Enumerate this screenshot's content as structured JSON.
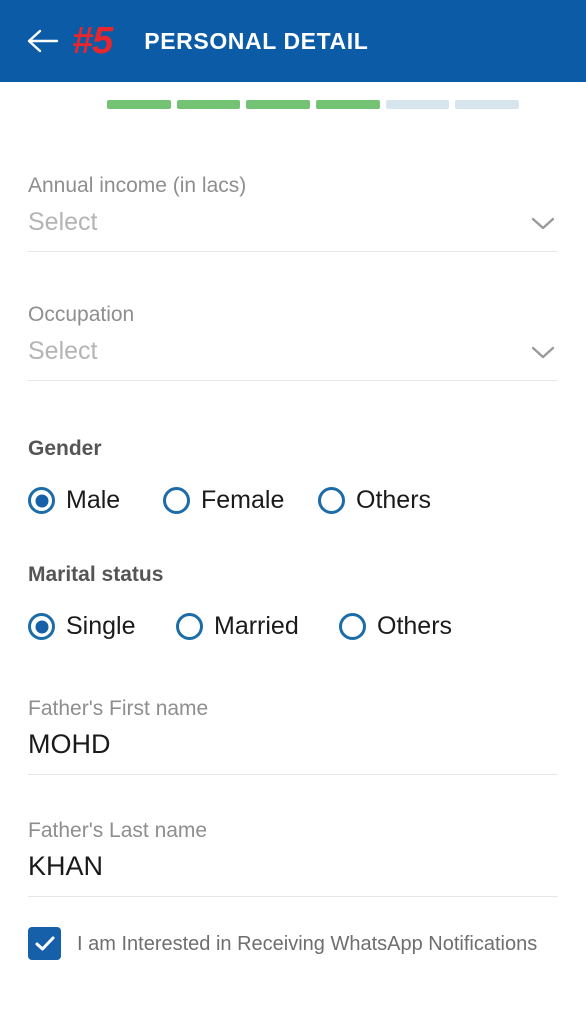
{
  "appbar": {
    "back_icon": "arrow-left-icon",
    "step_badge": "#5",
    "title": "PERSONAL DETAIL",
    "background_color": "#0b5ba6",
    "badge_color": "#e8262e",
    "title_color": "#ffffff"
  },
  "progress": {
    "total_steps": 6,
    "completed_steps": 4,
    "done_color": "#74c274",
    "todo_color": "#d7e5ef",
    "segments": [
      "done",
      "done",
      "done",
      "done",
      "todo",
      "todo"
    ]
  },
  "form": {
    "annual_income": {
      "label": "Annual income (in lacs)",
      "value": "",
      "placeholder": "Select",
      "icon": "chevron-down-icon"
    },
    "occupation": {
      "label": "Occupation",
      "value": "",
      "placeholder": "Select",
      "icon": "chevron-down-icon"
    },
    "gender": {
      "label": "Gender",
      "selected": "Male",
      "options": [
        "Male",
        "Female",
        "Others"
      ]
    },
    "marital_status": {
      "label": "Marital status",
      "selected": "Single",
      "options": [
        "Single",
        "Married",
        "Others"
      ]
    },
    "father_first_name": {
      "label": "Father's First name",
      "value": "MOHD"
    },
    "father_last_name": {
      "label": "Father's Last name",
      "value": "KHAN"
    },
    "whatsapp_opt_in": {
      "label": "I am Interested in Receiving WhatsApp Notifications",
      "checked": true,
      "accent_color": "#1560a8"
    }
  }
}
